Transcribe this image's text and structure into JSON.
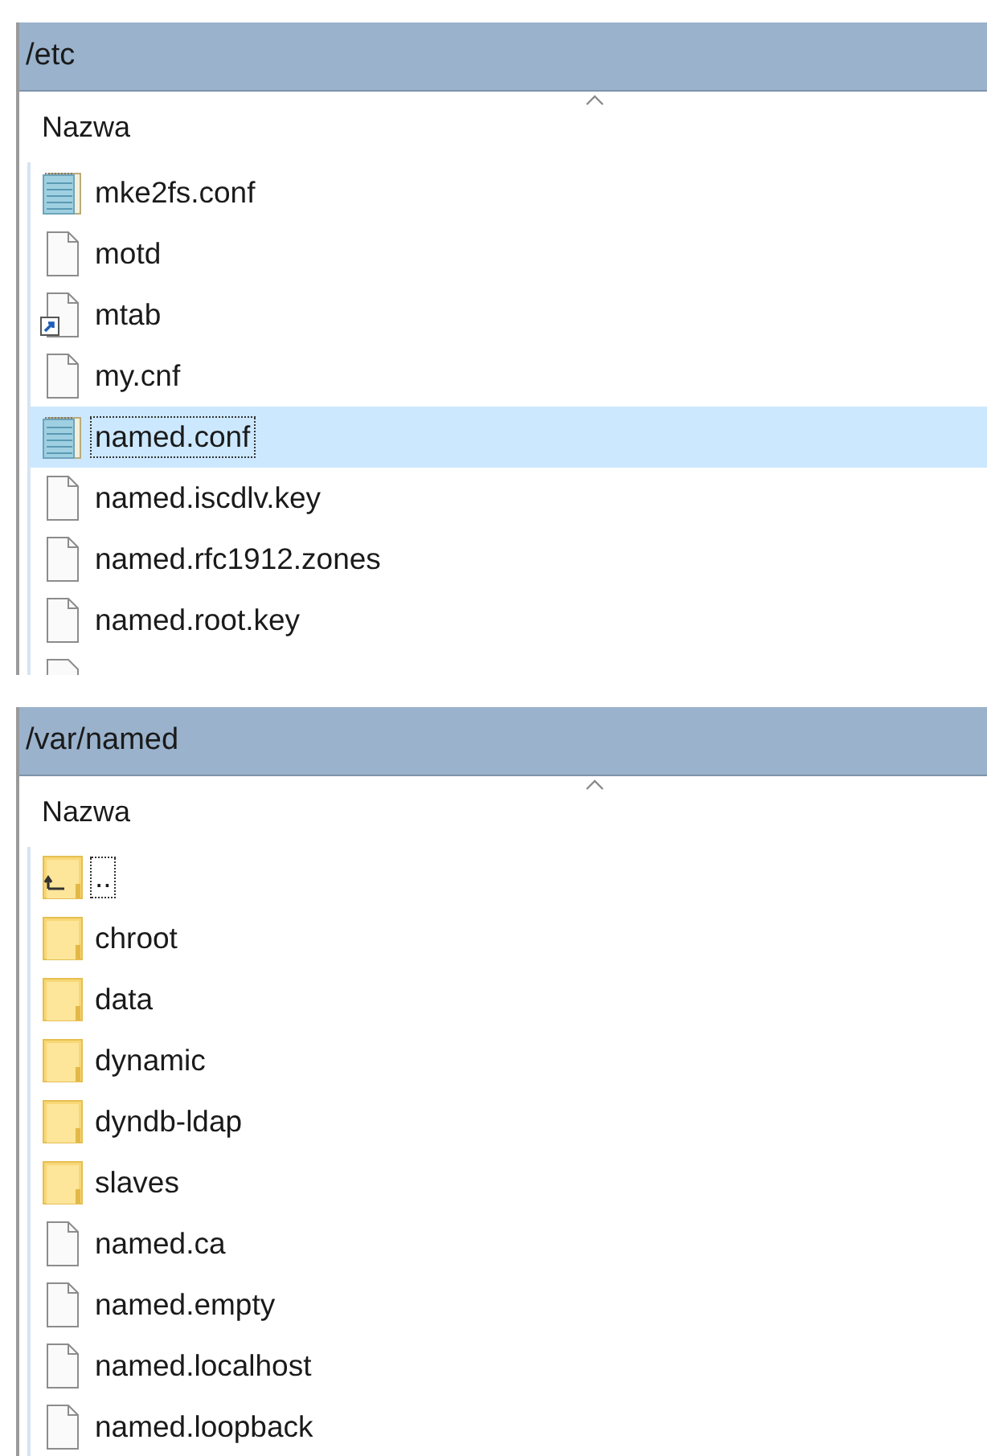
{
  "panels": [
    {
      "title": "/etc",
      "column": "Nazwa",
      "items": [
        {
          "name": "mke2fs.conf",
          "kind": "text",
          "selected": false,
          "focused": false
        },
        {
          "name": "motd",
          "kind": "file",
          "selected": false,
          "focused": false
        },
        {
          "name": "mtab",
          "kind": "link",
          "selected": false,
          "focused": false
        },
        {
          "name": "my.cnf",
          "kind": "file",
          "selected": false,
          "focused": false
        },
        {
          "name": "named.conf",
          "kind": "text",
          "selected": true,
          "focused": true
        },
        {
          "name": "named.iscdlv.key",
          "kind": "file",
          "selected": false,
          "focused": false
        },
        {
          "name": "named.rfc1912.zones",
          "kind": "file",
          "selected": false,
          "focused": false
        },
        {
          "name": "named.root.key",
          "kind": "file",
          "selected": false,
          "focused": false
        }
      ]
    },
    {
      "title": "/var/named",
      "column": "Nazwa",
      "items": [
        {
          "name": "..",
          "kind": "up",
          "selected": false,
          "focused": true
        },
        {
          "name": "chroot",
          "kind": "folder",
          "selected": false,
          "focused": false
        },
        {
          "name": "data",
          "kind": "folder",
          "selected": false,
          "focused": false
        },
        {
          "name": "dynamic",
          "kind": "folder",
          "selected": false,
          "focused": false
        },
        {
          "name": "dyndb-ldap",
          "kind": "folder",
          "selected": false,
          "focused": false
        },
        {
          "name": "slaves",
          "kind": "folder",
          "selected": false,
          "focused": false
        },
        {
          "name": "named.ca",
          "kind": "file",
          "selected": false,
          "focused": false
        },
        {
          "name": "named.empty",
          "kind": "file",
          "selected": false,
          "focused": false
        },
        {
          "name": "named.localhost",
          "kind": "file",
          "selected": false,
          "focused": false
        },
        {
          "name": "named.loopback",
          "kind": "file",
          "selected": false,
          "focused": false
        }
      ]
    }
  ]
}
